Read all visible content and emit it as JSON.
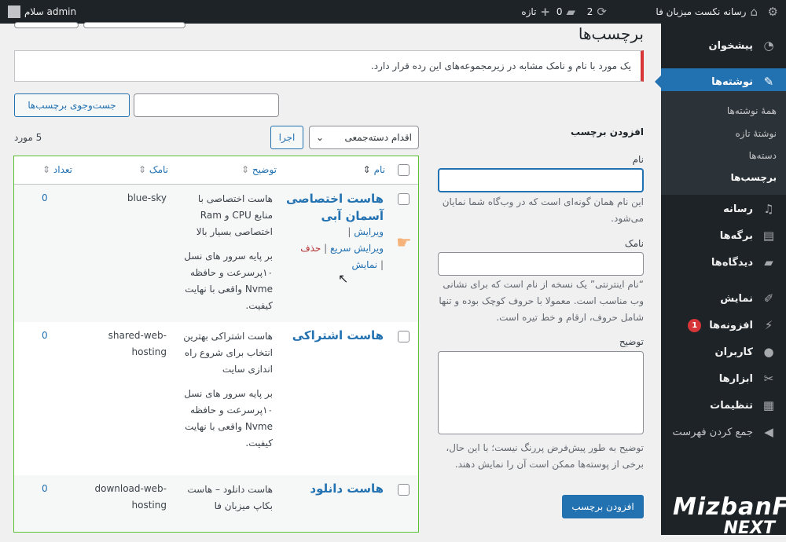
{
  "adminbar": {
    "site_name": "رسانه نکست میزبان فا",
    "updates": "2",
    "comments": "0",
    "new": "تازه",
    "greeting": "سلام admin"
  },
  "sidebar": {
    "items": [
      {
        "label": "پیشخوان",
        "icon": "dashboard-icon"
      },
      {
        "label": "نوشته‌ها",
        "icon": "pin-icon"
      },
      {
        "label": "رسانه",
        "icon": "media-icon"
      },
      {
        "label": "برگه‌ها",
        "icon": "pages-icon"
      },
      {
        "label": "دیدگاه‌ها",
        "icon": "comments-icon"
      },
      {
        "label": "نمایش",
        "icon": "appearance-icon"
      },
      {
        "label": "افزونه‌ها",
        "icon": "plugins-icon",
        "badge": "1"
      },
      {
        "label": "کاربران",
        "icon": "users-icon"
      },
      {
        "label": "ابزارها",
        "icon": "tools-icon"
      },
      {
        "label": "تنظیمات",
        "icon": "settings-icon"
      },
      {
        "label": "جمع کردن فهرست",
        "icon": "collapse-icon"
      }
    ],
    "submenu": [
      "همهٔ نوشته‌ها",
      "نوشتهٔ تازه",
      "دسته‌ها",
      "برچسب‌ها"
    ],
    "logo": {
      "line1": "MizbanFa",
      "line2": "NEXT"
    }
  },
  "page": {
    "title": "برچسب‌ها",
    "notice": "یک مورد با نام و نامک مشابه در زیرمجموعه‌های این رده قرار دارد.",
    "search_button": "جست‌وجوی برچسب‌ها",
    "bulk_action": "اقدام دسته‌جمعی",
    "apply": "اجرا",
    "count": "5 مورد"
  },
  "form": {
    "heading": "افزودن برچسب",
    "name_label": "نام",
    "name_help": "این نام همان گونه‌ای است که در وب‌گاه شما نمایان می‌شود.",
    "slug_label": "نامک",
    "slug_help": "“نام اینترنتی” یک نسخه از نام است که برای نشانی وب مناسب است. معمولا با حروف کوچک بوده و تنها شامل حروف، ارقام و خط تیره است.",
    "desc_label": "توضیح",
    "desc_help": "توضیح به طور پیش‌فرض پررنگ نیست؛ با این حال، برخی از پوسته‌ها ممکن است آن را نمایش دهند.",
    "submit": "افزودن برچسب"
  },
  "table": {
    "headers": {
      "name": "نام",
      "desc": "توضیح",
      "slug": "نامک",
      "count": "تعداد"
    },
    "row_actions": {
      "edit": "ویرایش",
      "quick_edit": "ویرایش سریع",
      "delete": "حذف",
      "view": "نمایش"
    },
    "rows": [
      {
        "name": "هاست اختصاصی آسمان آبی",
        "desc1": "هاست اختصاصی با منابع CPU و Ram اختصاصی بسیار بالا",
        "desc2": "بر پایه سرور های نسل ۱۰پرسرعت و حافظه Nvme واقعی با نهایت کیفیت.",
        "slug": "blue-sky",
        "count": "0"
      },
      {
        "name": "هاست اشتراکی",
        "desc1": "هاست اشتراکی بهترین انتخاب برای شروع راه اندازی سایت",
        "desc2": "بر پایه سرور های نسل ۱۰پرسرعت و حافظه Nvme واقعی با نهایت کیفیت.",
        "slug": "shared-web-hosting",
        "count": "0"
      },
      {
        "name": "هاست دانلود",
        "desc1": "هاست دانلود – هاست بکاپ میزبان فا",
        "desc2": "",
        "slug": "download-web-hosting",
        "count": "0"
      }
    ]
  }
}
